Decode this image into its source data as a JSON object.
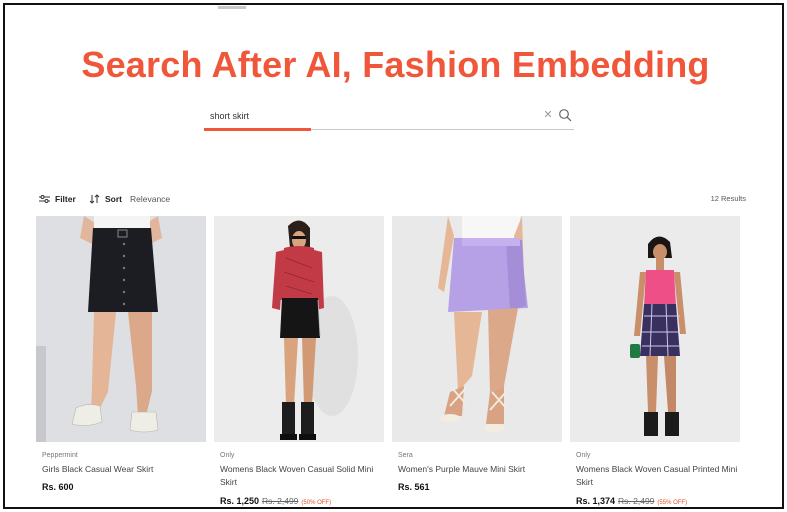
{
  "headline": "Search After AI, Fashion Embedding",
  "search": {
    "value": "short skirt",
    "placeholder": "Search",
    "clear_icon": "close-icon",
    "search_icon": "search-icon"
  },
  "toolbar": {
    "filter_label": "Filter",
    "sort_label": "Sort",
    "sort_value": "Relevance",
    "results": "12 Results"
  },
  "colors": {
    "accent": "#f0573a",
    "discount": "#e0522b",
    "card_background": "#e9e9e9"
  },
  "products": [
    {
      "brand": "Peppermint",
      "name": "Girls Black Casual Wear Skirt",
      "price": "Rs. 600",
      "mrp": "",
      "discount": ""
    },
    {
      "brand": "Only",
      "name": "Womens Black Woven Casual Solid Mini Skirt",
      "price": "Rs. 1,250",
      "mrp": "Rs. 2,499",
      "discount": "(50% OFF)"
    },
    {
      "brand": "Sera",
      "name": "Women's Purple Mauve Mini Skirt",
      "price": "Rs. 561",
      "mrp": "",
      "discount": ""
    },
    {
      "brand": "Only",
      "name": "Womens Black Woven Casual Printed Mini Skirt",
      "price": "Rs. 1,374",
      "mrp": "Rs. 2,499",
      "discount": "(55% OFF)"
    }
  ]
}
